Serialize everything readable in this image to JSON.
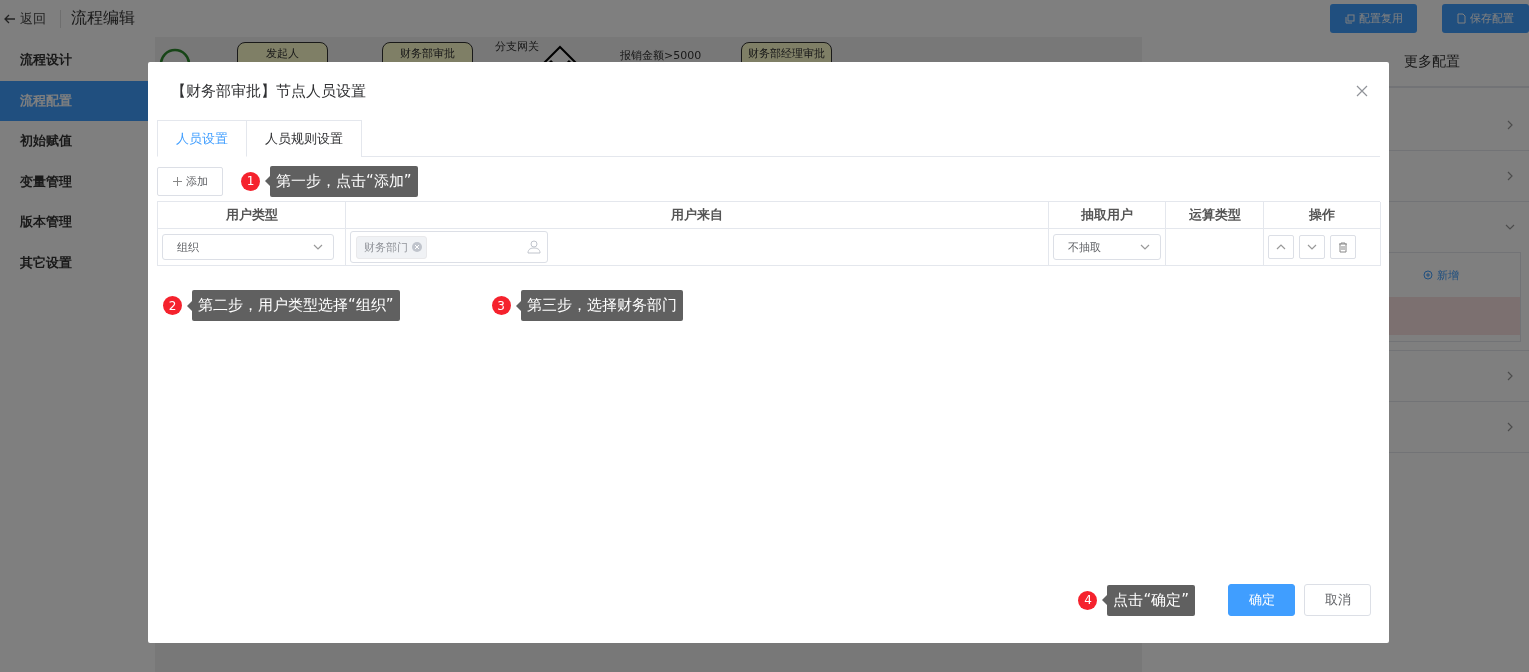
{
  "header": {
    "back_label": "返回",
    "title": "流程编辑",
    "buttons": [
      {
        "label": "配置复用"
      },
      {
        "label": "保存配置"
      }
    ]
  },
  "sidebar": {
    "items": [
      {
        "label": "流程设计",
        "selected": false
      },
      {
        "label": "流程配置",
        "selected": true
      },
      {
        "label": "初始赋值",
        "selected": false
      },
      {
        "label": "变量管理",
        "selected": false
      },
      {
        "label": "版本管理",
        "selected": false
      },
      {
        "label": "其它设置",
        "selected": false
      }
    ]
  },
  "flow": {
    "nodes": [
      {
        "kind": "start"
      },
      {
        "kind": "task",
        "label": "发起人"
      },
      {
        "kind": "task",
        "label": "财务部审批"
      },
      {
        "kind": "gateway",
        "label": "分支网关"
      },
      {
        "kind": "condition",
        "label": "报销金额>5000"
      },
      {
        "kind": "task",
        "label": "财务部经理审批"
      }
    ]
  },
  "right_panel": {
    "tabs": [
      {
        "label": "更多配置",
        "selected": false
      }
    ],
    "sections": [
      {
        "expanded": false
      },
      {
        "expanded": false
      },
      {
        "expanded": true,
        "action": "新增"
      },
      {
        "expanded": false
      },
      {
        "expanded": false
      }
    ]
  },
  "modal": {
    "title": "【财务部审批】节点人员设置",
    "tabs": [
      {
        "label": "人员设置",
        "selected": true
      },
      {
        "label": "人员规则设置",
        "selected": false
      }
    ],
    "add_button": "添加",
    "table": {
      "columns": [
        "用户类型",
        "用户来自",
        "抽取用户",
        "运算类型",
        "操作"
      ],
      "rows": [
        {
          "user_type": "组织",
          "tags": [
            "财务部门"
          ],
          "extract": "不抽取"
        }
      ]
    },
    "callouts": [
      {
        "number": "1",
        "text": "第一步，点击“添加”"
      },
      {
        "number": "2",
        "text": "第二步，用户类型选择“组织”"
      },
      {
        "number": "3",
        "text": "第三步，选择财务部门"
      },
      {
        "number": "4",
        "text": "点击“确定”"
      }
    ],
    "buttons": [
      {
        "label": "确定",
        "kind": "primary"
      },
      {
        "label": "取消",
        "kind": "default"
      }
    ]
  }
}
